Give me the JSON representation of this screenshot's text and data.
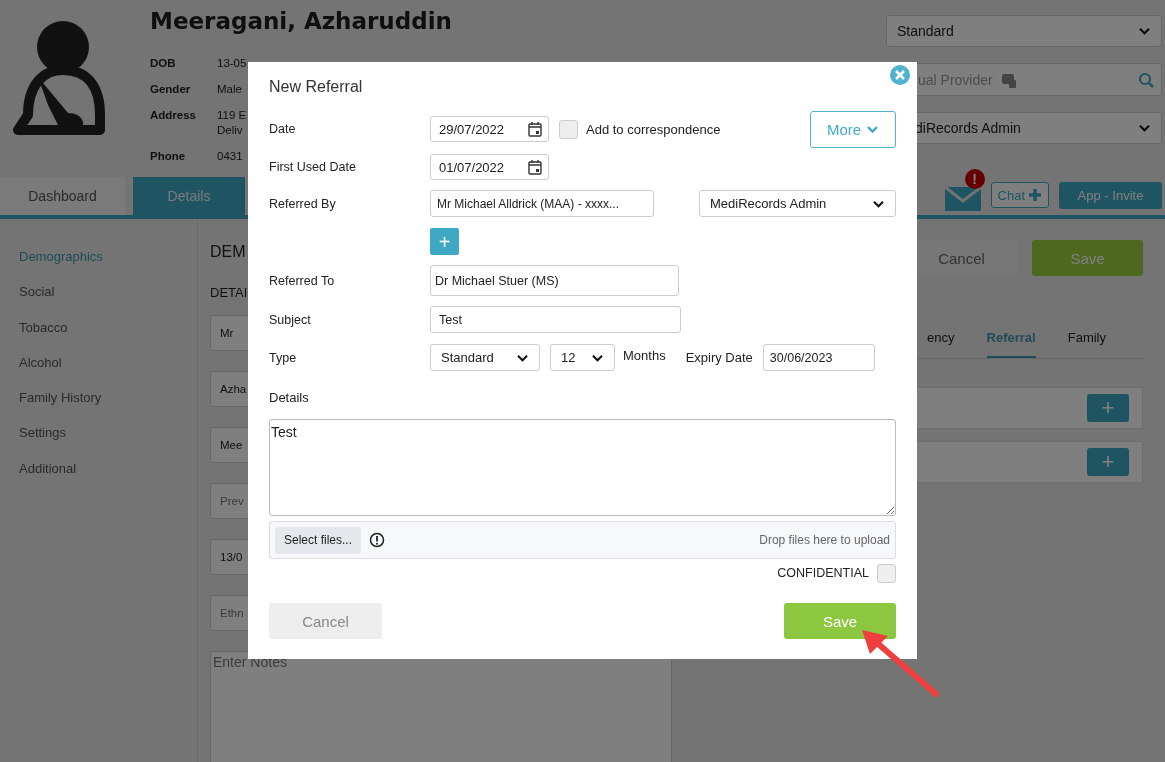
{
  "patient": {
    "name": "Meeragani, Azharuddin",
    "details": [
      {
        "label": "DOB",
        "lines": [
          "13-05"
        ]
      },
      {
        "label": "Gender",
        "lines": [
          "Male"
        ]
      },
      {
        "label": "Address",
        "lines": [
          "119 E",
          "Deliv"
        ]
      },
      {
        "label": "Phone",
        "lines": [
          "0431"
        ]
      }
    ]
  },
  "header_controls": {
    "view_select": "Standard",
    "provider_search": {
      "placeholder": "ual Provider"
    },
    "practice_select": "diRecords Admin"
  },
  "tabs": [
    {
      "label": "Dashboard",
      "selected": false
    },
    {
      "label": "Details",
      "selected": true
    }
  ],
  "toolbar": {
    "mail_alert": "!",
    "chat_button": "Chat",
    "invite_button": "App - Invite"
  },
  "sidebar": {
    "items": [
      {
        "label": "Demographics",
        "selected": true
      },
      {
        "label": "Social",
        "selected": false
      },
      {
        "label": "Tobacco",
        "selected": false
      },
      {
        "label": "Alcohol",
        "selected": false
      },
      {
        "label": "Family History",
        "selected": false
      },
      {
        "label": "Settings",
        "selected": false
      },
      {
        "label": "Additional",
        "selected": false
      }
    ]
  },
  "form": {
    "heading": "DEM",
    "section": "DETAI",
    "fields": [
      {
        "value": "Mr"
      },
      {
        "value": "Azha"
      },
      {
        "value": "Mee"
      },
      {
        "placeholder": "Prev"
      },
      {
        "value": "13/0"
      },
      {
        "placeholder": "Ethn"
      }
    ],
    "notes": {
      "placeholder": "Enter Notes"
    }
  },
  "actions": {
    "cancel": "Cancel",
    "save": "Save"
  },
  "subtabs": [
    {
      "label": "ency",
      "selected": false
    },
    {
      "label": "Referral",
      "selected": true
    },
    {
      "label": "Family",
      "selected": false
    }
  ],
  "panels": [
    {
      "button": "+"
    },
    {
      "button": "+"
    }
  ],
  "modal": {
    "title": "New Referral",
    "date": {
      "label": "Date",
      "value": "29/07/2022"
    },
    "add_to_correspondence": {
      "label": "Add to correspondence",
      "checked": false
    },
    "more_button": "More",
    "first_used_date": {
      "label": "First Used Date",
      "value": "01/07/2022"
    },
    "referred_by": {
      "label": "Referred By",
      "value": "Mr Michael Alldrick (MAA) - xxxx...",
      "practice": "MediRecords Admin",
      "add_button": "+"
    },
    "referred_to": {
      "label": "Referred To",
      "value": "Dr Michael Stuer (MS)"
    },
    "subject": {
      "label": "Subject",
      "value": "Test"
    },
    "type": {
      "label": "Type",
      "value": "Standard",
      "duration": "12",
      "unit": "Months"
    },
    "expiry_date": {
      "label": "Expiry Date",
      "value": "30/06/2023"
    },
    "details": {
      "label": "Details",
      "value": "Test"
    },
    "upload": {
      "button": "Select files...",
      "hint": "Drop files here to upload"
    },
    "confidential": {
      "label": "CONFIDENTIAL",
      "checked": false
    },
    "buttons": {
      "cancel": "Cancel",
      "save": "Save"
    }
  }
}
